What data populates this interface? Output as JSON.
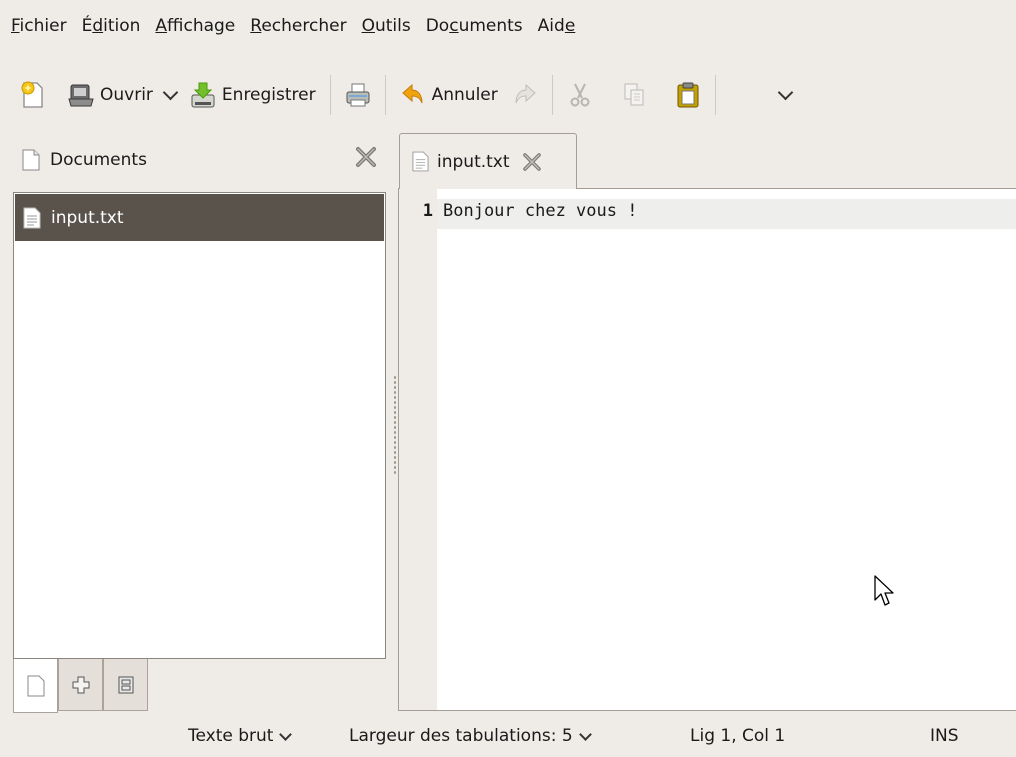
{
  "menubar": {
    "items": [
      {
        "pre": "",
        "u": "F",
        "post": "ichier"
      },
      {
        "pre": "É",
        "u": "d",
        "post": "ition"
      },
      {
        "pre": "",
        "u": "A",
        "post": "ffichage"
      },
      {
        "pre": "",
        "u": "R",
        "post": "echercher"
      },
      {
        "pre": "",
        "u": "O",
        "post": "utils"
      },
      {
        "pre": "Do",
        "u": "c",
        "post": "uments"
      },
      {
        "pre": "Aid",
        "u": "e",
        "post": ""
      }
    ]
  },
  "toolbar": {
    "open_label": "Ouvrir",
    "save_label": "Enregistrer",
    "undo_label": "Annuler"
  },
  "sidepanel": {
    "title": "Documents",
    "documents": [
      {
        "name": "input.txt"
      }
    ]
  },
  "editor": {
    "tab_label": "input.txt",
    "lines": [
      {
        "number": "1",
        "text": "Bonjour chez vous !"
      }
    ]
  },
  "statusbar": {
    "language": "Texte brut",
    "tab_width": "Largeur des tabulations: 5",
    "position": "Lig 1, Col 1",
    "mode": "INS"
  },
  "colors": {
    "selection": "#59534c",
    "window_bg": "#efebe7",
    "icon_yellow": "#f5c518",
    "icon_green": "#4e9a06",
    "icon_orange": "#f0a30a"
  }
}
